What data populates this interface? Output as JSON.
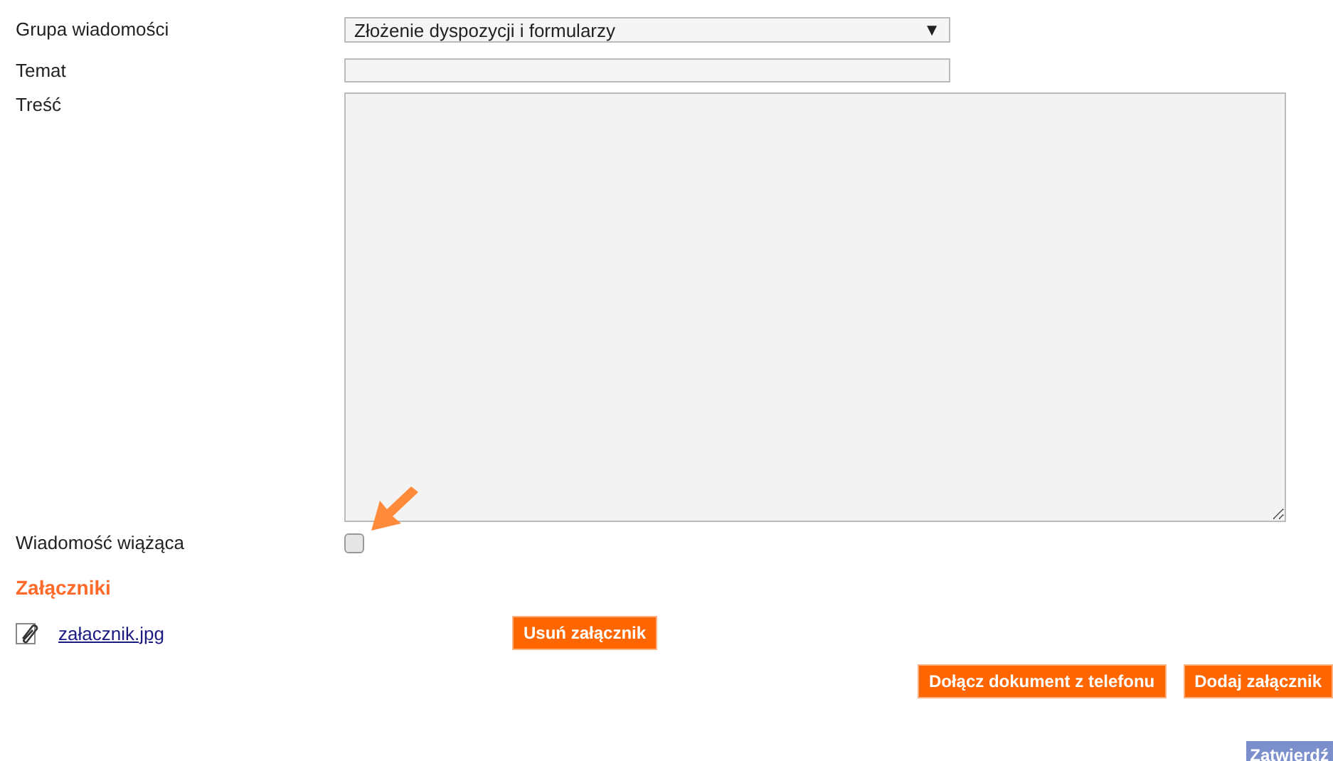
{
  "form": {
    "group": {
      "label": "Grupa wiadomości",
      "value": "Złożenie dyspozycji i formularzy",
      "caret": "▼"
    },
    "subject": {
      "label": "Temat"
    },
    "content": {
      "label": "Treść"
    },
    "binding": {
      "label": "Wiadomość wiążąca",
      "checked": false
    }
  },
  "attachments": {
    "heading": "Załączniki",
    "items": [
      {
        "name": "załacznik.jpg",
        "remove_label": "Usuń załącznik"
      }
    ]
  },
  "actions": [
    "Dołącz dokument z telefonu",
    "Dodaj załącznik"
  ],
  "submit": "Zatwierdź"
}
